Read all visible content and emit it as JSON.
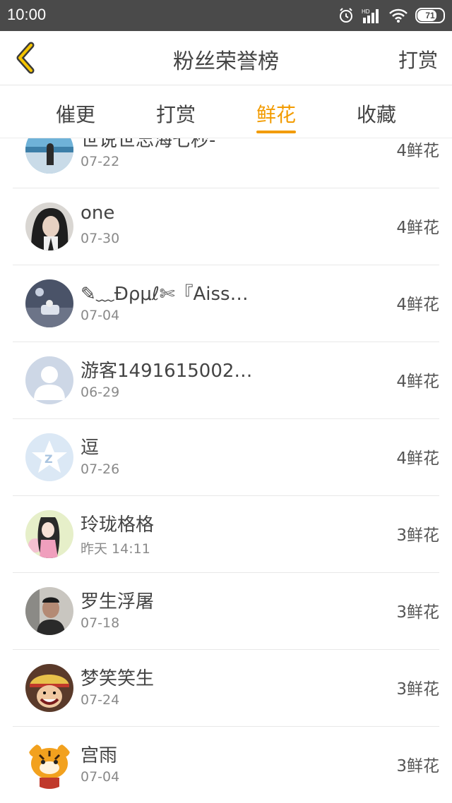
{
  "status_bar": {
    "time": "10:00",
    "battery": "71"
  },
  "header": {
    "title": "粉丝荣誉榜",
    "action_label": "打赏"
  },
  "tabs": [
    {
      "label": "催更",
      "active": false
    },
    {
      "label": "打赏",
      "active": false
    },
    {
      "label": "鲜花",
      "active": true
    },
    {
      "label": "收藏",
      "active": false
    }
  ],
  "accent_color": "#f29b00",
  "fans": [
    {
      "name": "世说世忘海七秒-",
      "date": "07-22",
      "count": "4鲜花",
      "avatar": "sea-girl"
    },
    {
      "name": "one",
      "date": "07-30",
      "count": "4鲜花",
      "avatar": "dark-hair"
    },
    {
      "name": "✎﹏Ɖρμℓ✄『Aiss…",
      "date": "07-04",
      "count": "4鲜花",
      "avatar": "dusk-scene"
    },
    {
      "name": "游客1491615002…",
      "date": "06-29",
      "count": "4鲜花",
      "avatar": "default-person"
    },
    {
      "name": "逗",
      "date": "07-26",
      "count": "4鲜花",
      "avatar": "star-logo"
    },
    {
      "name": "玲珑格格",
      "date": "昨天 14:11",
      "count": "3鲜花",
      "avatar": "anime-girl"
    },
    {
      "name": "罗生浮屠",
      "date": "07-18",
      "count": "3鲜花",
      "avatar": "boy-photo"
    },
    {
      "name": "梦笑笑生",
      "date": "07-24",
      "count": "3鲜花",
      "avatar": "cartoon-pirate"
    },
    {
      "name": "宫雨",
      "date": "07-04",
      "count": "3鲜花",
      "avatar": "tiger-cartoon"
    }
  ]
}
